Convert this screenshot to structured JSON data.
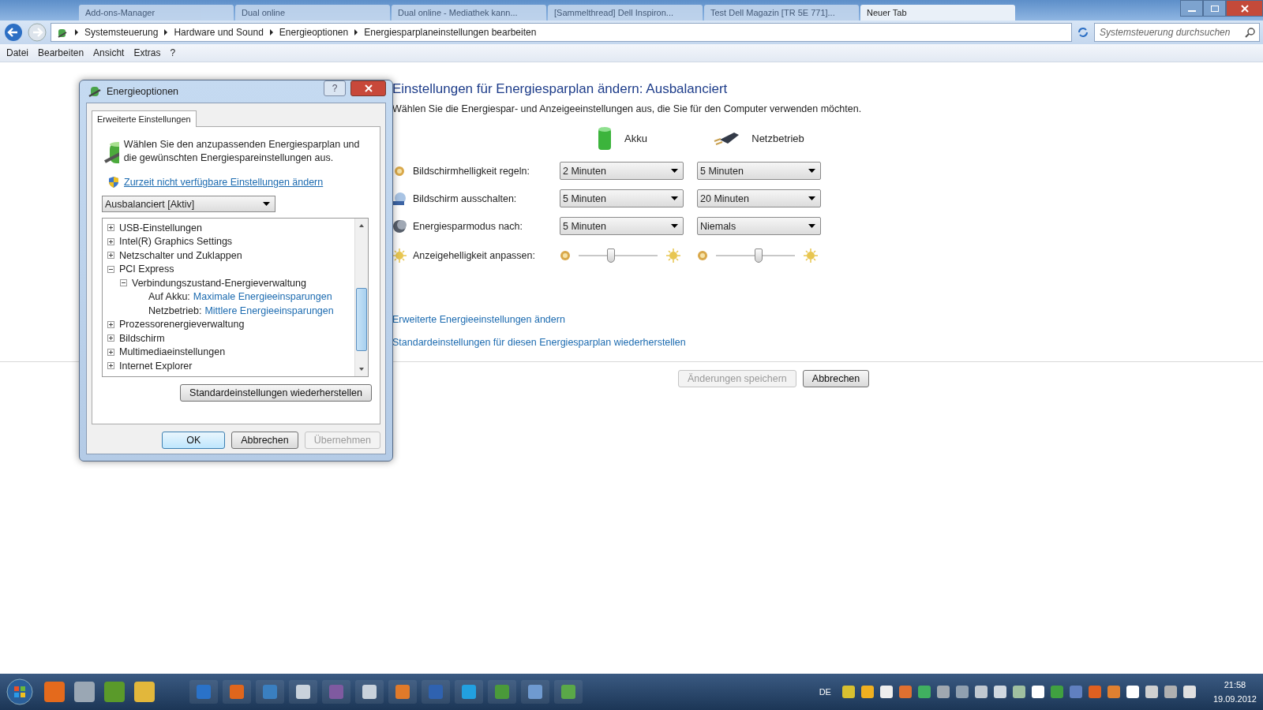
{
  "browser_tabs": [
    {
      "label": "Add-ons-Manager",
      "selected": false
    },
    {
      "label": "Dual online",
      "selected": false
    },
    {
      "label": "Dual online - Mediathek kann...",
      "selected": false
    },
    {
      "label": "[Sammelthread] Dell Inspiron...",
      "selected": false
    },
    {
      "label": "Test Dell Magazin [TR 5E 771]...",
      "selected": false
    },
    {
      "label": "Neuer Tab",
      "selected": true
    }
  ],
  "address_bar": {
    "breadcrumbs": [
      "Systemsteuerung",
      "Hardware und Sound",
      "Energieoptionen",
      "Energiesparplaneinstellungen bearbeiten"
    ]
  },
  "search": {
    "placeholder": "Systemsteuerung durchsuchen"
  },
  "menu": [
    "Datei",
    "Bearbeiten",
    "Ansicht",
    "Extras",
    "?"
  ],
  "page": {
    "title": "Einstellungen für Energiesparplan ändern: Ausbalanciert",
    "subtitle": "Wählen Sie die Energiespar- und Anzeigeeinstellungen aus, die Sie für den Computer verwenden möchten.",
    "columns": [
      "Akku",
      "Netzbetrieb"
    ],
    "settings": [
      {
        "kind": "dropdown",
        "label": "Bildschirmhelligkeit regeln:",
        "cells": [
          {
            "value": "2 Minuten"
          },
          {
            "value": "5 Minuten"
          }
        ]
      },
      {
        "kind": "dropdown",
        "label": "Bildschirm ausschalten:",
        "cells": [
          {
            "value": "5 Minuten"
          },
          {
            "value": "20 Minuten"
          }
        ]
      },
      {
        "kind": "dropdown",
        "label": "Energiesparmodus nach:",
        "cells": [
          {
            "value": "5 Minuten"
          },
          {
            "value": "Niemals"
          }
        ]
      },
      {
        "kind": "slider",
        "label": "Anzeigehelligkeit anpassen:",
        "cells": [
          {
            "level": 0.41
          },
          {
            "level": 0.54
          }
        ]
      }
    ],
    "links": [
      "Erweiterte Energieeinstellungen ändern",
      "Standardeinstellungen für diesen Energiesparplan wiederherstellen"
    ],
    "buttons": [
      {
        "label": "Änderungen speichern",
        "disabled": true
      },
      {
        "label": "Abbrechen",
        "disabled": false
      }
    ]
  },
  "dialog": {
    "title": "Energieoptionen",
    "help_label": "?",
    "tabs": [
      {
        "label": "Erweiterte Einstellungen",
        "selected": true
      }
    ],
    "intro": "Wählen Sie den anzupassenden Energiesparplan und die gewünschten Energiespareinstellungen aus.",
    "link": "Zurzeit nicht verfügbare Einstellungen ändern",
    "plan": {
      "value": "Ausbalanciert [Aktiv]"
    },
    "tree": [
      {
        "kind": "group",
        "label": "USB-Einstellungen",
        "expanded": false
      },
      {
        "kind": "group",
        "label": "Intel(R) Graphics Settings",
        "expanded": false
      },
      {
        "kind": "group",
        "label": "Netzschalter und Zuklappen",
        "expanded": false
      },
      {
        "kind": "group",
        "label": "PCI Express",
        "expanded": true,
        "children": [
          {
            "kind": "group",
            "label": "Verbindungszustand-Energieverwaltung",
            "expanded": true,
            "children": [
              {
                "kind": "setting",
                "label": "Auf Akku:",
                "value": "Maximale Energieeinsparungen"
              },
              {
                "kind": "setting",
                "label": "Netzbetrieb:",
                "value": "Mittlere Energieeinsparungen"
              }
            ]
          }
        ]
      },
      {
        "kind": "group",
        "label": "Prozessorenergieverwaltung",
        "expanded": false
      },
      {
        "kind": "group",
        "label": "Bildschirm",
        "expanded": false
      },
      {
        "kind": "group",
        "label": "Multimediaeinstellungen",
        "expanded": false
      },
      {
        "kind": "group",
        "label": "Internet Explorer",
        "expanded": false
      }
    ],
    "restore_button": "Standardeinstellungen wiederherstellen",
    "buttons": [
      {
        "label": "OK",
        "disabled": false
      },
      {
        "label": "Abbrechen",
        "disabled": false
      },
      {
        "label": "Übernehmen",
        "disabled": true
      }
    ]
  },
  "taskbar": {
    "language": "DE",
    "time": "21:58",
    "date": "19.09.2012"
  }
}
